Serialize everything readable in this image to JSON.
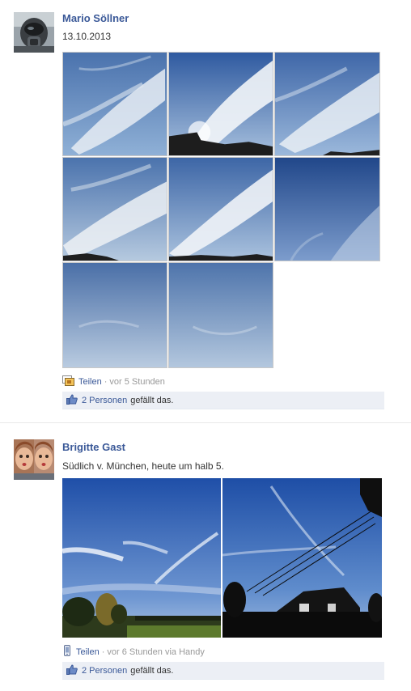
{
  "posts": [
    {
      "author": "Mario Söllner",
      "message": "13.10.2013",
      "share_label": "Teilen",
      "separator": "·",
      "time": "vor 5 Stunden",
      "likes_people": "2 Personen",
      "likes_text": "gefällt das.",
      "photo_count": 8
    },
    {
      "author": "Brigitte Gast",
      "message": "Südlich v. München, heute um halb 5.",
      "share_label": "Teilen",
      "separator": "·",
      "time": "vor 6 Stunden via Handy",
      "likes_people": "2 Personen",
      "likes_text": "gefällt das.",
      "photo_count": 2
    }
  ],
  "colors": {
    "link": "#3b5998",
    "likes_bg": "#eceff5",
    "sky_light": "#9fbcdc",
    "sky_dark": "#2f5aa0"
  },
  "icons": {
    "post1_meta": "share-photo-icon",
    "post2_meta": "mobile-phone-icon",
    "likes": "thumbs-up-icon"
  }
}
